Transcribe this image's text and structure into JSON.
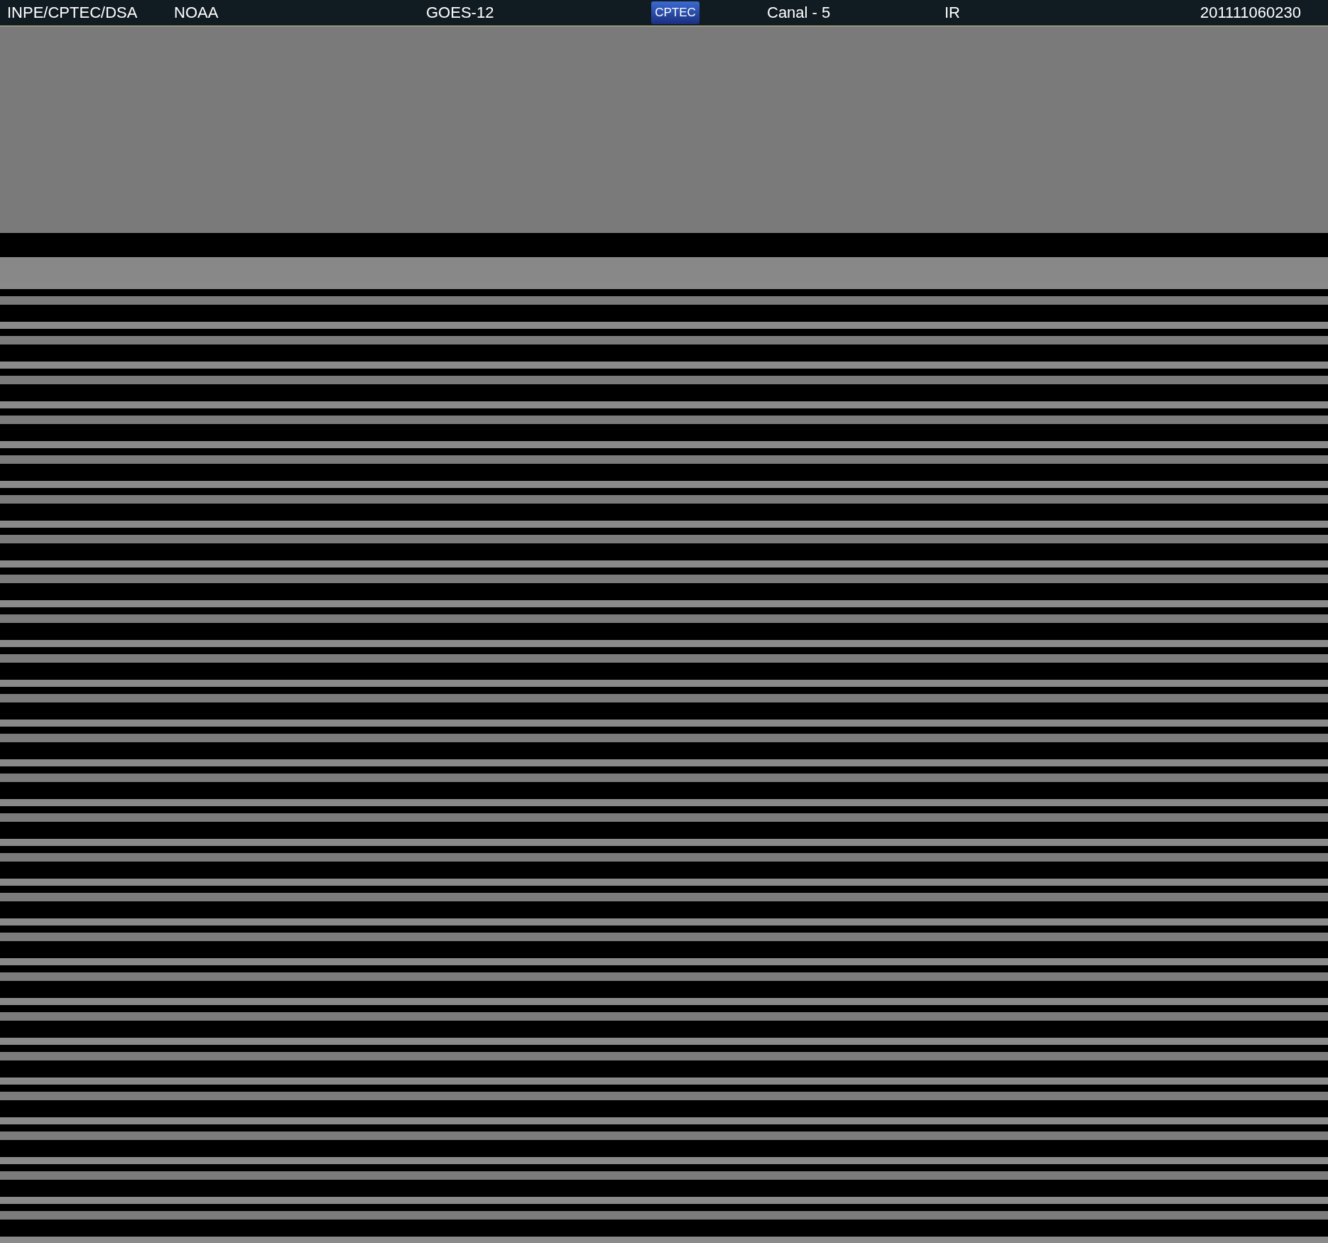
{
  "header": {
    "source": "INPE/CPTEC/DSA",
    "agency": "NOAA",
    "satellite": "GOES-12",
    "logo": "CPTEC",
    "channel": "Canal - 5",
    "band": "IR",
    "timestamp": "201111060230"
  }
}
